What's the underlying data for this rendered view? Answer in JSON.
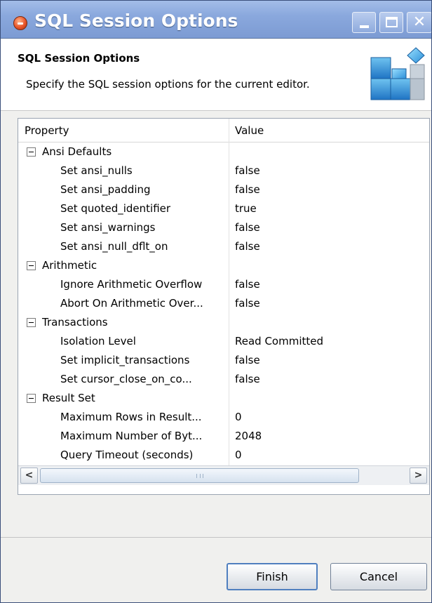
{
  "window": {
    "title": "SQL Session Options"
  },
  "header": {
    "title": "SQL Session Options",
    "description": "Specify the SQL session options for the current editor.",
    "icon": "database-cubes-icon"
  },
  "table": {
    "columns": [
      "Property",
      "Value"
    ],
    "groups": [
      {
        "label": "Ansi Defaults",
        "items": [
          {
            "property": "Set ansi_nulls",
            "value": "false"
          },
          {
            "property": "Set ansi_padding",
            "value": "false"
          },
          {
            "property": "Set quoted_identifier",
            "value": "true"
          },
          {
            "property": "Set ansi_warnings",
            "value": "false"
          },
          {
            "property": "Set ansi_null_dflt_on",
            "value": "false"
          }
        ]
      },
      {
        "label": "Arithmetic",
        "items": [
          {
            "property": "Ignore Arithmetic Overflow",
            "value": "false"
          },
          {
            "property": "Abort On Arithmetic Over...",
            "value": "false"
          }
        ]
      },
      {
        "label": "Transactions",
        "items": [
          {
            "property": "Isolation Level",
            "value": "Read Committed"
          },
          {
            "property": "Set implicit_transactions",
            "value": "false"
          },
          {
            "property": "Set cursor_close_on_co...",
            "value": "false"
          }
        ]
      },
      {
        "label": "Result Set",
        "items": [
          {
            "property": "Maximum Rows in Result...",
            "value": "0"
          },
          {
            "property": "Maximum Number of Byt...",
            "value": "2048"
          },
          {
            "property": "Query Timeout (seconds)",
            "value": "0"
          }
        ]
      }
    ]
  },
  "buttons": {
    "finish": "Finish",
    "cancel": "Cancel"
  },
  "scrollbar": {
    "left_arrow": "<",
    "right_arrow": ">"
  }
}
